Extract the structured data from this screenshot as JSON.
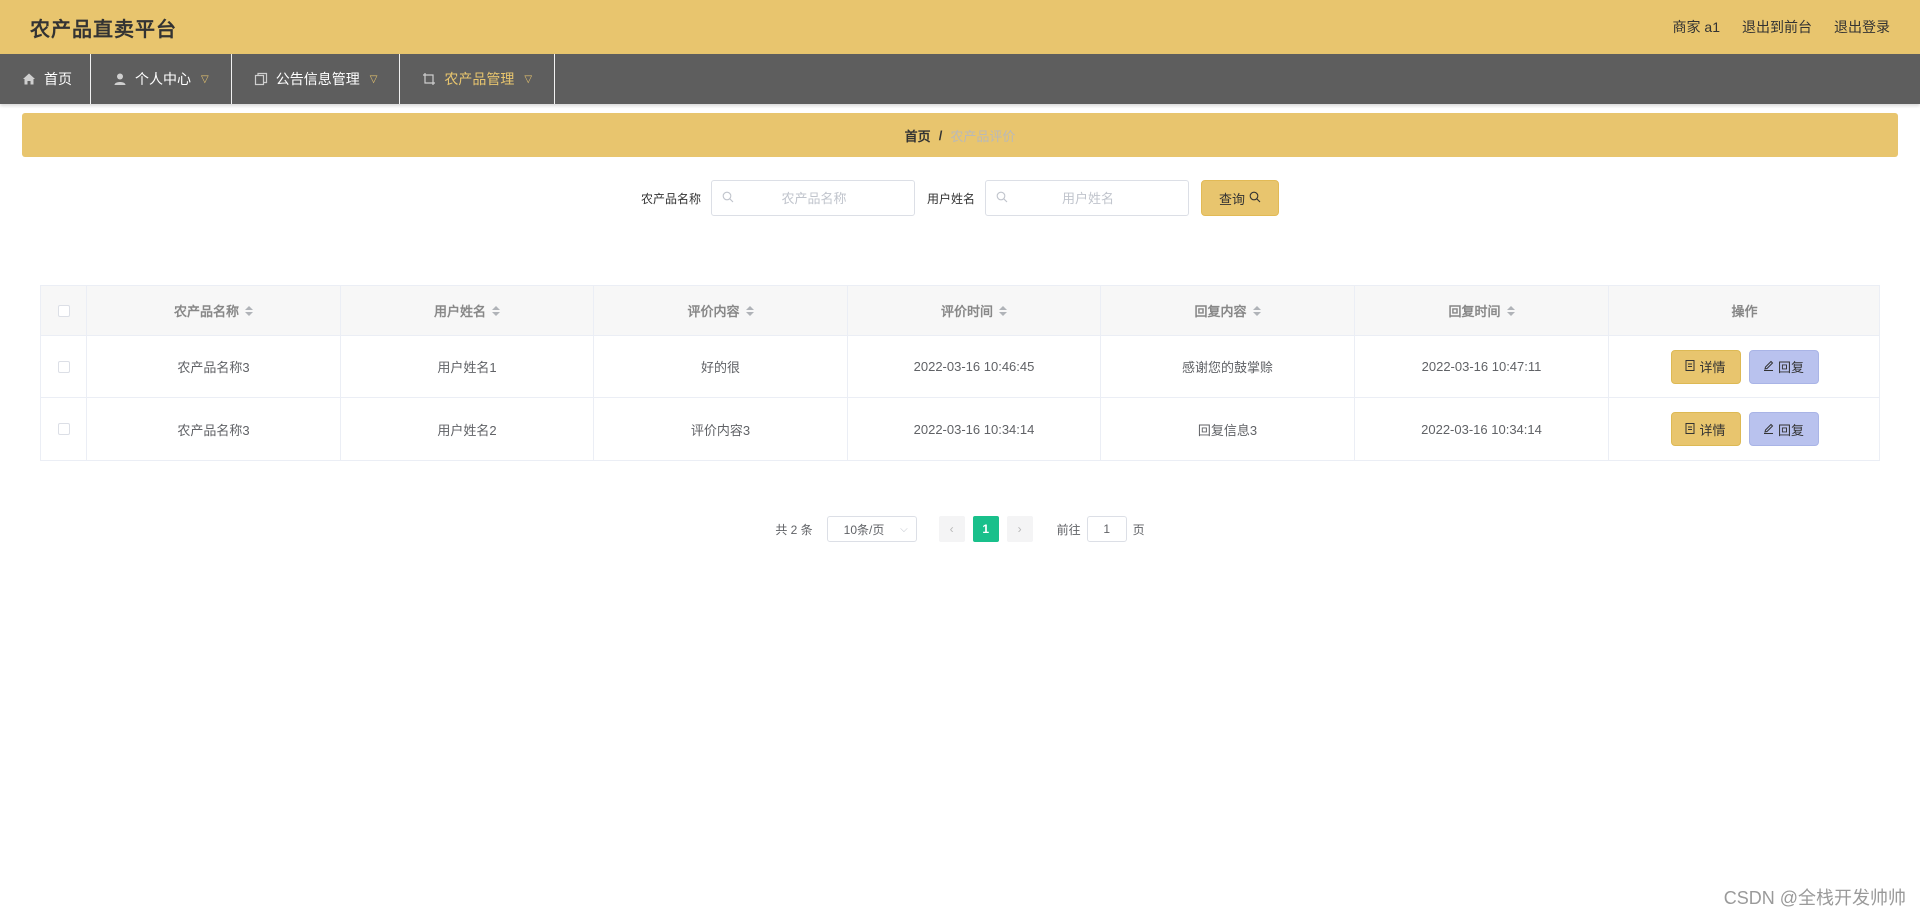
{
  "header": {
    "title": "农产品直卖平台",
    "user": "商家 a1",
    "to_front": "退出到前台",
    "logout": "退出登录"
  },
  "nav": {
    "items": [
      {
        "label": "首页",
        "icon": "home-icon"
      },
      {
        "label": "个人中心",
        "icon": "user-icon"
      },
      {
        "label": "公告信息管理",
        "icon": "copy-icon"
      },
      {
        "label": "农产品管理",
        "icon": "crop-icon"
      }
    ]
  },
  "breadcrumb": {
    "home": "首页",
    "separator": "/",
    "current": "农产品评价"
  },
  "search": {
    "product_label": "农产品名称",
    "product_placeholder": "农产品名称",
    "user_label": "用户姓名",
    "user_placeholder": "用户姓名",
    "query_label": "查询"
  },
  "table": {
    "headers": [
      "农产品名称",
      "用户姓名",
      "评价内容",
      "评价时间",
      "回复内容",
      "回复时间",
      "操作"
    ],
    "rows": [
      {
        "product": "农产品名称3",
        "user": "用户姓名1",
        "content": "好的很",
        "time": "2022-03-16 10:46:45",
        "reply": "感谢您的鼓掌赊",
        "reply_time": "2022-03-16 10:47:11"
      },
      {
        "product": "农产品名称3",
        "user": "用户姓名2",
        "content": "评价内容3",
        "time": "2022-03-16 10:34:14",
        "reply": "回复信息3",
        "reply_time": "2022-03-16 10:34:14"
      }
    ],
    "detail_label": "详情",
    "reply_label": "回复"
  },
  "pagination": {
    "total": "共 2 条",
    "page_size": "10条/页",
    "current_page": "1",
    "goto_prefix": "前往",
    "goto_value": "1",
    "goto_suffix": "页"
  },
  "watermark": "CSDN @全栈开发帅帅",
  "colors": {
    "accent": "#e8c56e",
    "nav_bg": "#5e5e5e",
    "reply_button": "#b9c2ee",
    "active_page": "#19c08b"
  }
}
